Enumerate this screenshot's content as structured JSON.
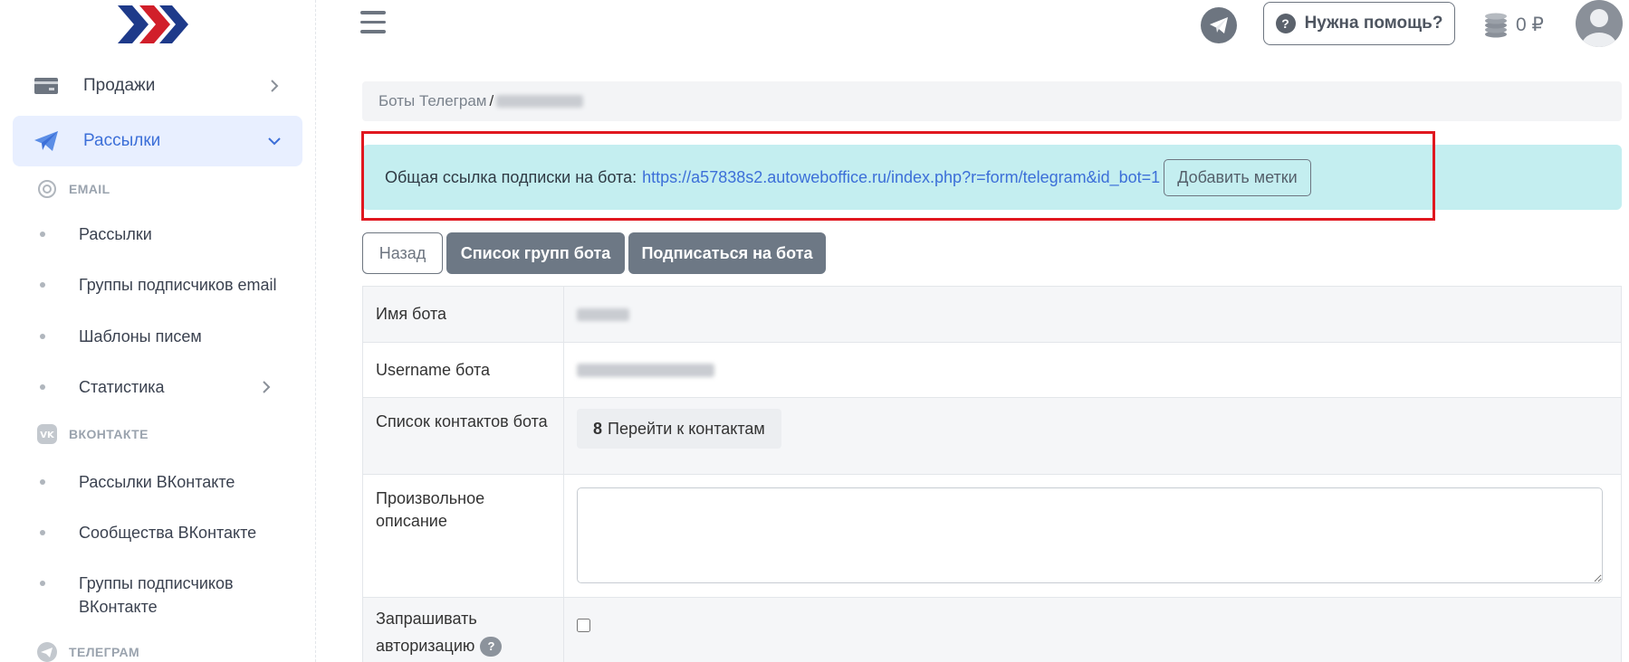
{
  "sidebar": {
    "items": [
      {
        "label": "Продажи",
        "icon": "credit-card-icon"
      },
      {
        "label": "Рассылки",
        "icon": "paper-plane-icon"
      }
    ],
    "email_section": "EMAIL",
    "email_items": [
      {
        "label": "Рассылки"
      },
      {
        "label": "Группы подписчиков email"
      },
      {
        "label": "Шаблоны писем"
      },
      {
        "label": "Статистика"
      }
    ],
    "vk_section": "ВКОНТАКТЕ",
    "vk_items": [
      {
        "label": "Рассылки ВКонтакте"
      },
      {
        "label": "Сообщества ВКонтакте"
      },
      {
        "label": "Группы подписчиков ВКонтакте"
      }
    ],
    "tg_section": "ТЕЛЕГРАМ"
  },
  "header": {
    "help_label": "Нужна помощь?",
    "balance": "0 ₽"
  },
  "breadcrumb": {
    "root": "Боты Телеграм",
    "separator": "/"
  },
  "alert": {
    "text": "Общая ссылка подписки на бота:",
    "link": "https://a57838s2.autoweboffice.ru/index.php?r=form/telegram&id_bot=1",
    "marks_button": "Добавить метки"
  },
  "actions": {
    "back": "Назад",
    "groups": "Список групп бота",
    "subscribe": "Подписаться на бота"
  },
  "table": {
    "rows": [
      {
        "label": "Имя бота"
      },
      {
        "label": "Username бота"
      },
      {
        "label": "Список контактов бота",
        "count": "8",
        "link": "Перейти к контактам"
      },
      {
        "label": "Произвольное описание"
      },
      {
        "label": "Запрашивать авторизацию"
      }
    ]
  },
  "colors": {
    "accent": "#3c6fd8",
    "active_bg": "#e8efff",
    "alert_bg": "#c4eef0",
    "highlight": "#e0171f",
    "button_bg": "#6d7885"
  }
}
